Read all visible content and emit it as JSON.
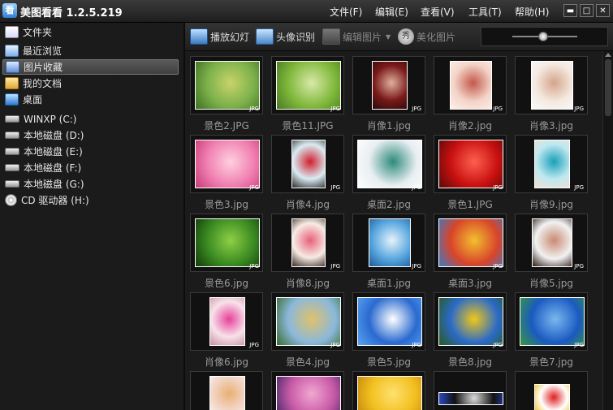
{
  "app": {
    "icon_glyph": "看",
    "title": "美图看看 1.2.5.219"
  },
  "menu": [
    "文件(F)",
    "编辑(E)",
    "查看(V)",
    "工具(T)",
    "帮助(H)"
  ],
  "window_controls": [
    "▬",
    "□",
    "✕"
  ],
  "sidebar": {
    "items": [
      {
        "label": "文件夹",
        "icon": "folder-icon"
      },
      {
        "label": "最近浏览",
        "icon": "recent-icon"
      },
      {
        "label": "图片收藏",
        "icon": "favorites-icon",
        "selected": true
      },
      {
        "label": "我的文档",
        "icon": "documents-icon"
      },
      {
        "label": "桌面",
        "icon": "desktop-icon"
      },
      {
        "label": "WINXP (C:)",
        "icon": "drive-icon"
      },
      {
        "label": "本地磁盘 (D:)",
        "icon": "drive-icon"
      },
      {
        "label": "本地磁盘 (E:)",
        "icon": "drive-icon"
      },
      {
        "label": "本地磁盘 (F:)",
        "icon": "drive-icon"
      },
      {
        "label": "本地磁盘 (G:)",
        "icon": "drive-icon"
      },
      {
        "label": "CD 驱动器 (H:)",
        "icon": "cd-icon"
      }
    ]
  },
  "toolbar": {
    "slideshow_label": "播放幻灯",
    "face_label": "头像识别",
    "edit_label": "编辑图片",
    "beautify_label": "美化图片",
    "beautify_glyph": "秀"
  },
  "thumbnails": [
    {
      "name": "景色2.JPG",
      "tag": "JPG",
      "colors": [
        "#7bb04a",
        "#c9d46a",
        "#3f6f22"
      ]
    },
    {
      "name": "景色11.JPG",
      "tag": "JPG",
      "colors": [
        "#7fb83a",
        "#d8e9a8",
        "#4a7a24"
      ]
    },
    {
      "name": "肖像1.jpg",
      "tag": "JPG",
      "colors": [
        "#7a1a1a",
        "#e0b09a",
        "#2a0a0a"
      ]
    },
    {
      "name": "肖像2.jpg",
      "tag": "JPG",
      "colors": [
        "#f3d4c8",
        "#c3584a",
        "#fff0ea"
      ]
    },
    {
      "name": "肖像3.jpg",
      "tag": "JPG",
      "colors": [
        "#f4e9e0",
        "#d5a58a",
        "#fafafa"
      ]
    },
    {
      "name": "景色3.jpg",
      "tag": "JPG",
      "colors": [
        "#f07fb0",
        "#ffd0e0",
        "#c83b78"
      ]
    },
    {
      "name": "肖像4.jpg",
      "tag": "JPG",
      "colors": [
        "#d8ecf2",
        "#d21e2e",
        "#2a2a2a"
      ]
    },
    {
      "name": "桌面2.jpg",
      "tag": "JPG",
      "colors": [
        "#e8eef2",
        "#2e8a7a",
        "#ffffff"
      ]
    },
    {
      "name": "景色1.JPG",
      "tag": "JPG",
      "colors": [
        "#c81010",
        "#ff6050",
        "#5a0a08"
      ]
    },
    {
      "name": "肖像9.jpg",
      "tag": "JPG",
      "colors": [
        "#bfe8f0",
        "#1aa0b8",
        "#f2e0d4"
      ]
    },
    {
      "name": "景色6.jpg",
      "tag": "JPG",
      "colors": [
        "#3a8a22",
        "#8ed046",
        "#123a0a"
      ]
    },
    {
      "name": "肖像8.jpg",
      "tag": "JPG",
      "colors": [
        "#f6ece4",
        "#e8607a",
        "#3a2a22"
      ]
    },
    {
      "name": "桌面1.jpg",
      "tag": "JPG",
      "colors": [
        "#5aa8e0",
        "#e8f2fa",
        "#1a5a9a"
      ]
    },
    {
      "name": "桌面3.jpg",
      "tag": "JPG",
      "colors": [
        "#d8442a",
        "#f2c030",
        "#3a7ac8"
      ]
    },
    {
      "name": "肖像5.jpg",
      "tag": "JPG",
      "colors": [
        "#f2f2f2",
        "#c88a72",
        "#2a1a14"
      ]
    },
    {
      "name": "肖像6.jpg",
      "tag": "JPG",
      "colors": [
        "#f7e2ea",
        "#e8409a",
        "#c890a0"
      ]
    },
    {
      "name": "景色4.jpg",
      "tag": "JPG",
      "colors": [
        "#8ab8dc",
        "#e0c26a",
        "#3a6a2a"
      ]
    },
    {
      "name": "景色5.jpg",
      "tag": "JPG",
      "colors": [
        "#2a6ad0",
        "#ffffff",
        "#5aa4f0"
      ]
    },
    {
      "name": "景色8.jpg",
      "tag": "JPG",
      "colors": [
        "#2a6ac8",
        "#f2c818",
        "#2a5a1a"
      ]
    },
    {
      "name": "景色7.jpg",
      "tag": "JPG",
      "colors": [
        "#1a5ac0",
        "#7ab8f0",
        "#3a9a3a"
      ]
    },
    {
      "name": "",
      "tag": "",
      "colors": [
        "#f2d2c2",
        "#e8b070",
        "#f8f2ea"
      ]
    },
    {
      "name": "",
      "tag": "",
      "colors": [
        "#c85aa8",
        "#f2a8d0",
        "#4a2a6a"
      ]
    },
    {
      "name": "",
      "tag": "",
      "colors": [
        "#f2c020",
        "#ffe070",
        "#c88a10"
      ]
    },
    {
      "name": "",
      "tag": "",
      "colors": [
        "#111111",
        "#dcdcdc",
        "#2a4ac8"
      ]
    },
    {
      "name": "",
      "tag": "",
      "colors": [
        "#ffffff",
        "#e02020",
        "#f2c020"
      ]
    }
  ]
}
